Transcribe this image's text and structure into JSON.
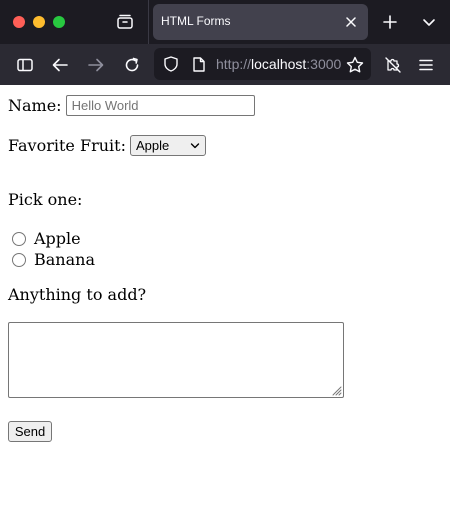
{
  "browser": {
    "tab_title": "HTML Forms",
    "url_scheme": "http://",
    "url_host": "localhost",
    "url_rest": ":3000"
  },
  "form": {
    "name_label": "Name:",
    "name_placeholder": "Hello World",
    "fruit_label": "Favorite Fruit:",
    "fruit_selected": "Apple",
    "pick_label": "Pick one:",
    "radio_options": [
      "Apple",
      "Banana"
    ],
    "comment_label": "Anything to add?",
    "send_label": "Send"
  },
  "colors": {
    "tabbar_bg": "#1c1b22",
    "navbar_bg": "#2b2a33",
    "active_tab_bg": "#42414d"
  }
}
